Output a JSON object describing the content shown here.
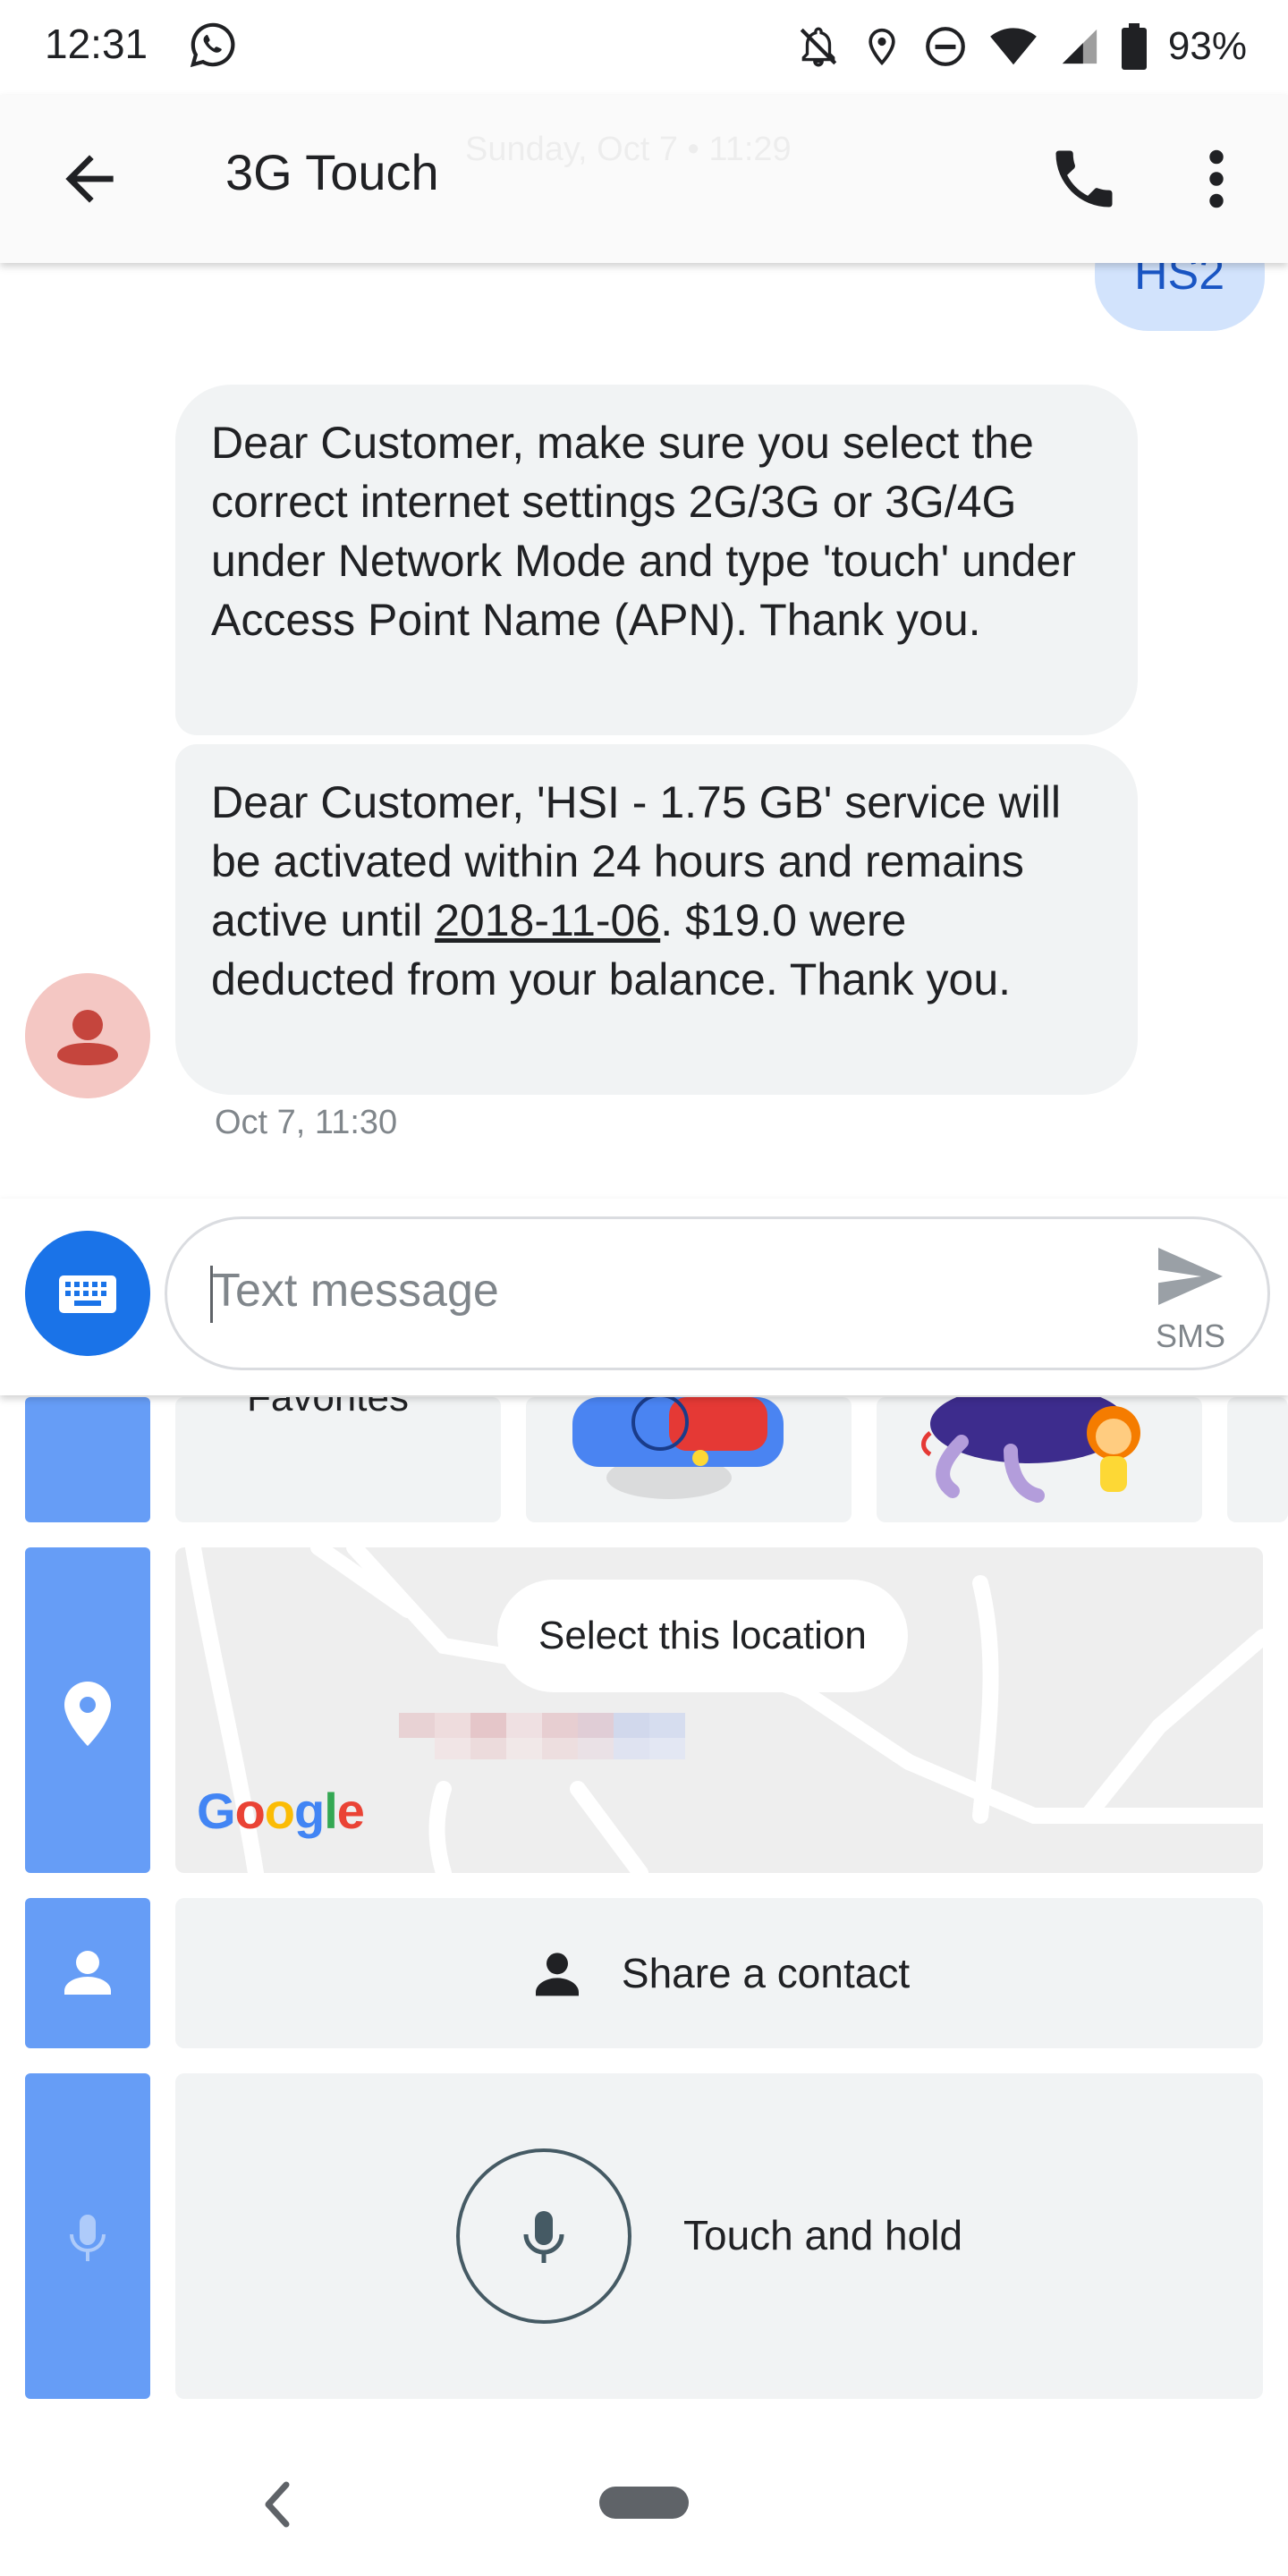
{
  "status_bar": {
    "time": "12:31",
    "battery": "93%",
    "icons": [
      "whatsapp-icon",
      "notifications-off-icon",
      "location-icon",
      "do-not-disturb-icon",
      "wifi-icon",
      "signal-icon",
      "battery-icon"
    ]
  },
  "app_bar": {
    "title": "3G Touch",
    "ghost_date": "Sunday, Oct 7 • 11:29",
    "icons": [
      "back-arrow-icon",
      "phone-icon",
      "more-vert-icon"
    ]
  },
  "conversation": {
    "partial_sent": "HS2",
    "messages": [
      {
        "text": "Dear Customer, make sure you select the correct internet settings 2G/3G or 3G/4G under Network Mode and type 'touch' under Access Point Name (APN). Thank you."
      },
      {
        "text_before": "Dear Customer, 'HSI - 1.75 GB' service will be activated within 24 hours and remains active until ",
        "date_link": "2018-11-06",
        "text_after": ". $19.0 were deducted from your balance. Thank you."
      }
    ],
    "timestamp": "Oct 7, 11:30"
  },
  "compose": {
    "placeholder": "Text message",
    "send_type": "SMS"
  },
  "attachments": {
    "favorites_label": "Favorites",
    "location_button": "Select this location",
    "map_logo": "Google",
    "share_contact_label": "Share a contact",
    "voice_label": "Touch and hold"
  },
  "colors": {
    "accent": "#1a73e8",
    "side_tab": "#669df6",
    "bubble": "#f1f3f4",
    "sent_bubble": "#d2e3fc",
    "avatar_bg": "#f4c7c3",
    "avatar_fg": "#c5453d"
  }
}
